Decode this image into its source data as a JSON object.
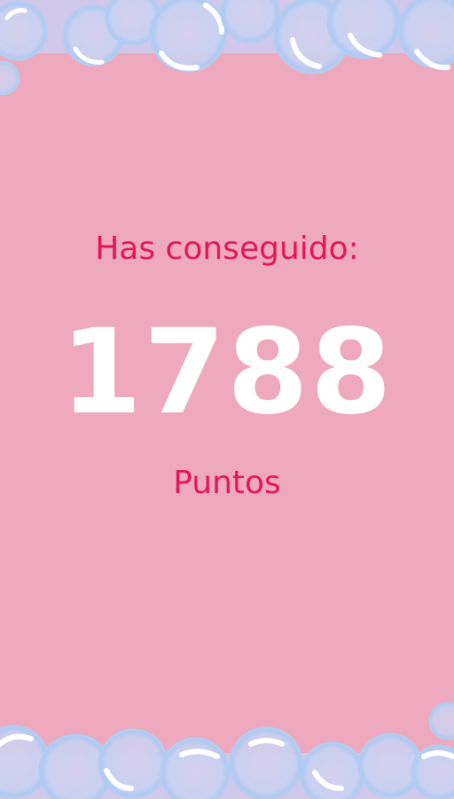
{
  "result": {
    "heading": "Has conseguido:",
    "score": "1788",
    "unit": "Puntos"
  },
  "decoration": {
    "icon": "bubble-icon"
  },
  "colors": {
    "background": "#eea9be",
    "label": "#e4145a",
    "score": "#ffffff",
    "bubble_fill": "#c9d4f2",
    "bubble_stroke": "#a9c3ee"
  }
}
